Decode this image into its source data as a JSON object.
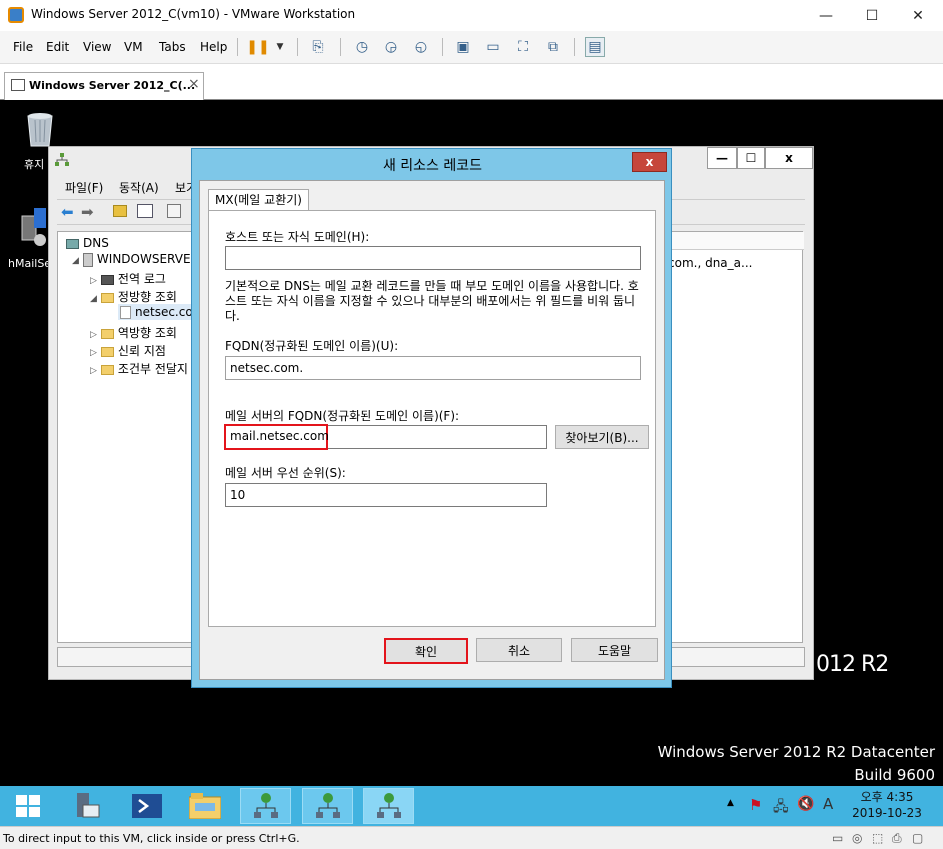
{
  "window": {
    "title": "Windows Server 2012_C(vm10) - VMware Workstation",
    "minimize": "—",
    "maximize": "☐",
    "close": "✕"
  },
  "menu": {
    "file": "File",
    "edit": "Edit",
    "view": "View",
    "vm": "VM",
    "tabs": "Tabs",
    "help": "Help"
  },
  "tab": {
    "label": "Windows Server 2012_C(...",
    "close": "×"
  },
  "desktop": {
    "recycle_bin_label": "휴지",
    "hmail_label": "hMailSe",
    "watermark_edition": "012 R2",
    "watermark_line1": "Windows Server 2012 R2 Datacenter",
    "watermark_line2": "Build 9600"
  },
  "dns_window": {
    "menu_file": "파일(F)",
    "menu_action": "동작(A)",
    "menu_view": "보기",
    "tree_root": "DNS",
    "tree_server": "WINDOWSERVEF",
    "tree_global_log": "전역 로그",
    "tree_forward": "정방향 조회",
    "tree_zone": "netsec.co",
    "tree_reverse": "역방향 조회",
    "tree_trust": "신뢰 지점",
    "tree_conditional": "조건부 전달지",
    "right_text": "com., dna_a...",
    "right_text2": "."
  },
  "dialog": {
    "title": "새 리소스 레코드",
    "close": "x",
    "tab_label": "MX(메일 교환기)",
    "host_label": "호스트 또는 자식 도메인(H):",
    "host_value": "",
    "description": "기본적으로 DNS는 메일 교환 레코드를 만들 때 부모 도메인 이름을 사용합니다. 호스트 또는 자식 이름을 지정할 수 있으나 대부분의 배포에서는 위 필드를 비워 둡니다.",
    "fqdn_label": "FQDN(정규화된 도메인 이름)(U):",
    "fqdn_value": "netsec.com.",
    "mailserver_label": "메일 서버의 FQDN(정규화된 도메인 이름)(F):",
    "mailserver_value": "mail.netsec.com",
    "browse_button": "찾아보기(B)...",
    "priority_label": "메일 서버 우선 순위(S):",
    "priority_value": "10",
    "ok_button": "확인",
    "cancel_button": "취소",
    "help_button": "도움말"
  },
  "taskbar": {
    "time": "오후 4:35",
    "date": "2019-10-23",
    "ime": "A"
  },
  "status": {
    "text": "To direct input to this VM, click inside or press Ctrl+G."
  },
  "colors": {
    "highlight_red": "#e3141b",
    "taskbar_blue": "#41b3e0",
    "dialog_frame": "#7ec7e8"
  }
}
